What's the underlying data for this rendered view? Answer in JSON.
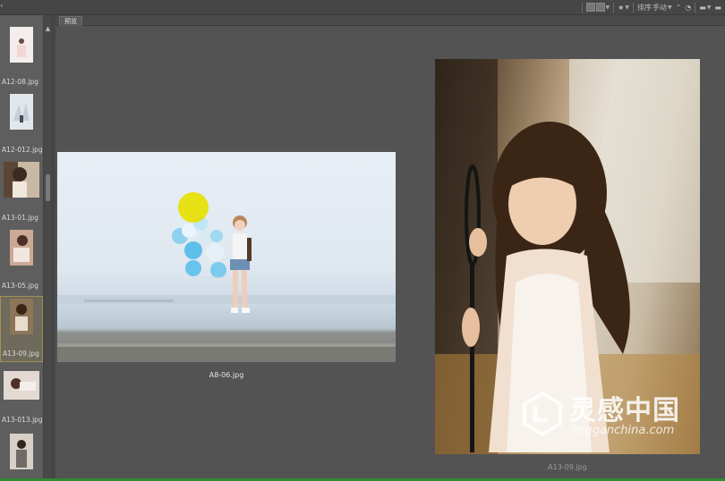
{
  "toolbar": {
    "sort_label": "排序",
    "sort_value": "手动",
    "star_label": "★"
  },
  "tabs": [
    {
      "label": "预览"
    }
  ],
  "filmstrip": {
    "items": [
      {
        "label": "A12-08.jpg"
      },
      {
        "label": "A12-012.jpg"
      },
      {
        "label": "A13-01.jpg"
      },
      {
        "label": "A13-05.jpg"
      },
      {
        "label": "A13-09.jpg",
        "selected": true
      },
      {
        "label": "A13-013.jpg"
      },
      {
        "label": ""
      }
    ]
  },
  "preview": {
    "images": [
      {
        "caption": "A8-06.jpg"
      },
      {
        "caption": "A13-09.jpg"
      }
    ]
  },
  "watermark": {
    "title": "灵感中国",
    "subtitle": "lingganchina.com"
  },
  "colors": {
    "cursor_highlight": "#e6e100",
    "selection_border": "#a38f55",
    "bottom_strip": "#2e8b2e"
  }
}
